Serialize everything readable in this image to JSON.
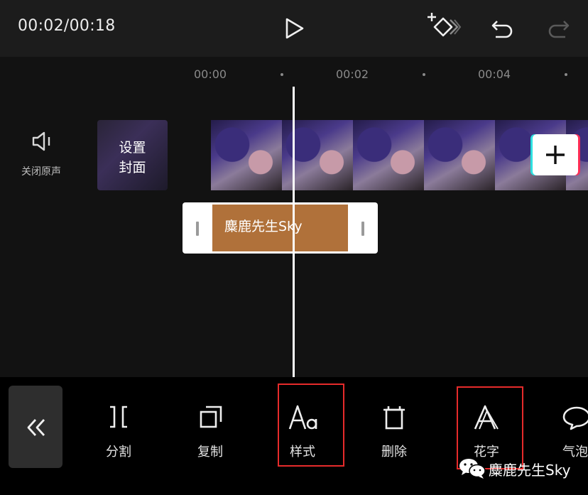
{
  "header": {
    "time": "00:02/00:18",
    "icons": [
      "play-icon",
      "keyframe-add-icon",
      "undo-icon",
      "redo-icon"
    ]
  },
  "ruler": {
    "labels": [
      "00:00",
      "00:02",
      "00:04"
    ]
  },
  "audio": {
    "mute_label": "关闭原声",
    "icon": "speaker-icon"
  },
  "cover": {
    "line1": "设置",
    "line2": "封面"
  },
  "text_clip": {
    "label": "麋鹿先生Sky"
  },
  "toolbar": {
    "back_icon": "double-chevron-left-icon",
    "tools": [
      {
        "label": "分割",
        "icon": "split-icon"
      },
      {
        "label": "复制",
        "icon": "copy-icon"
      },
      {
        "label": "样式",
        "icon": "text-style-icon",
        "highlighted": true
      },
      {
        "label": "删除",
        "icon": "delete-icon"
      },
      {
        "label": "花字",
        "icon": "fancy-text-icon",
        "highlighted": true
      },
      {
        "label": "气泡",
        "icon": "bubble-icon"
      }
    ]
  },
  "watermark": {
    "text": "麋鹿先生Sky",
    "icon": "wechat-icon"
  },
  "colors": {
    "accent_highlight": "#e62b2b",
    "text_clip": "#b0713a",
    "background": "#111111"
  }
}
